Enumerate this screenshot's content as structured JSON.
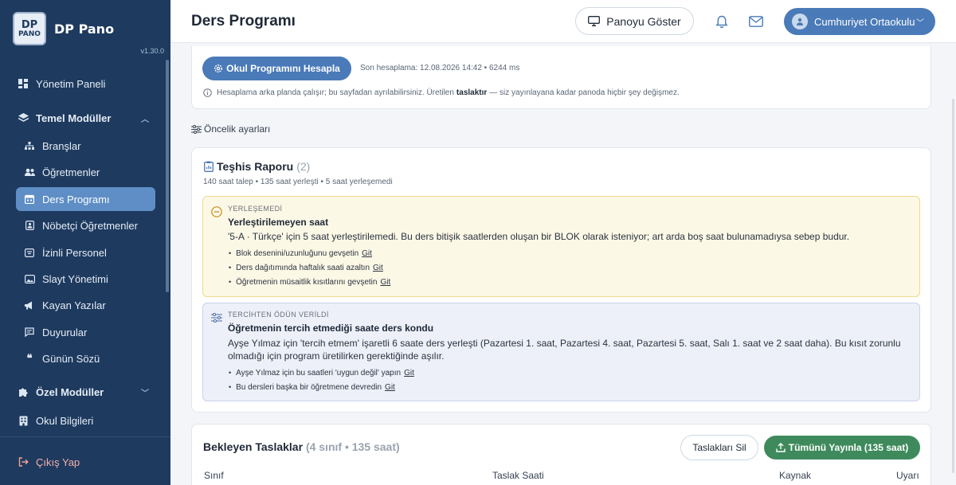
{
  "brand": {
    "logo_top": "DP",
    "logo_bottom": "PANO",
    "name": "DP Pano",
    "version": "v1.30.0"
  },
  "sidebar": {
    "items": [
      {
        "label": "Yönetim Paneli",
        "icon": "dashboard-icon"
      },
      {
        "label": "Temel Modüller",
        "icon": "layers-icon"
      },
      {
        "label": "Branşlar",
        "icon": "sitemap-icon"
      },
      {
        "label": "Öğretmenler",
        "icon": "users-icon"
      },
      {
        "label": "Ders Programı",
        "icon": "calendar-icon",
        "active": true
      },
      {
        "label": "Nöbetçi Öğretmenler",
        "icon": "id-badge-icon"
      },
      {
        "label": "İzinli Personel",
        "icon": "calendar-off-icon"
      },
      {
        "label": "Slayt Yönetimi",
        "icon": "image-icon"
      },
      {
        "label": "Kayan Yazılar",
        "icon": "megaphone-icon"
      },
      {
        "label": "Duyurular",
        "icon": "message-icon"
      },
      {
        "label": "Günün Sözü",
        "icon": "quote-icon"
      },
      {
        "label": "Özel Modüller",
        "icon": "puzzle-icon"
      },
      {
        "label": "Okul Bilgileri",
        "icon": "building-icon"
      }
    ],
    "logout": "Çıkış Yap"
  },
  "header": {
    "title": "Ders Programı",
    "show_board": "Panoyu Göster",
    "user": "Cumhuriyet Ortaokulu"
  },
  "calc": {
    "button": "Okul Programını Hesapla",
    "last": "Son hesaplama: 12.08.2026 14:42 • 6244 ms",
    "info_pre": "Hesaplama arka planda çalışır; bu sayfadan ayrılabilirsiniz. Üretilen",
    "info_bold": "taslaktır",
    "info_post": "— siz yayınlayana kadar panoda hiçbir şey değişmez."
  },
  "priority": {
    "label": "Öncelik ayarları"
  },
  "diagnosis": {
    "title": "Teşhis Raporu",
    "count": "(2)",
    "summary": "140 saat talep • 135 saat yerleşti • 5 saat yerleşemedi",
    "alerts": [
      {
        "tag": "YERLEŞEMEDİ",
        "title": "Yerleştirilemeyen saat",
        "body": "'5-A · Türkçe' için 5 saat yerleştirilemedi. Bu ders bitişik saatlerden oluşan bir BLOK olarak isteniyor; art arda boş saat bulunamadıysa sebep budur.",
        "actions": [
          {
            "text": "Blok desenini/uzunluğunu gevşetin",
            "link": "Git"
          },
          {
            "text": "Ders dağıtımında haftalık saati azaltın",
            "link": "Git"
          },
          {
            "text": "Öğretmenin müsaitlik kısıtlarını gevşetin",
            "link": "Git"
          }
        ]
      },
      {
        "tag": "TERCİHTEN ÖDÜN VERİLDİ",
        "title": "Öğretmenin tercih etmediği saate ders kondu",
        "body": "Ayşe Yılmaz için 'tercih etmem' işaretli 6 saate ders yerleşti (Pazartesi 1. saat, Pazartesi 4. saat, Pazartesi 5. saat, Salı 1. saat ve 2 saat daha). Bu kısıt zorunlu olmadığı için program üretilirken gerektiğinde aşılır.",
        "actions": [
          {
            "text": "Ayşe Yılmaz için bu saatleri 'uygun değil' yapın",
            "link": "Git"
          },
          {
            "text": "Bu dersleri başka bir öğretmene devredin",
            "link": "Git"
          }
        ]
      }
    ]
  },
  "drafts": {
    "title": "Bekleyen Taslaklar",
    "count": "(4 sınıf • 135 saat)",
    "clear": "Taslakları Sil",
    "publish": "Tümünü Yayınla (135 saat)",
    "columns": [
      "Sınıf",
      "Taslak Saati",
      "Kaynak",
      "Uyarı"
    ]
  },
  "colors": {
    "sidebar": "#1e3a5f",
    "primary": "#4a7ab8",
    "success": "#3e8a5c",
    "warn_bg": "#fcf8e6",
    "pref_bg": "#edf0f9"
  }
}
